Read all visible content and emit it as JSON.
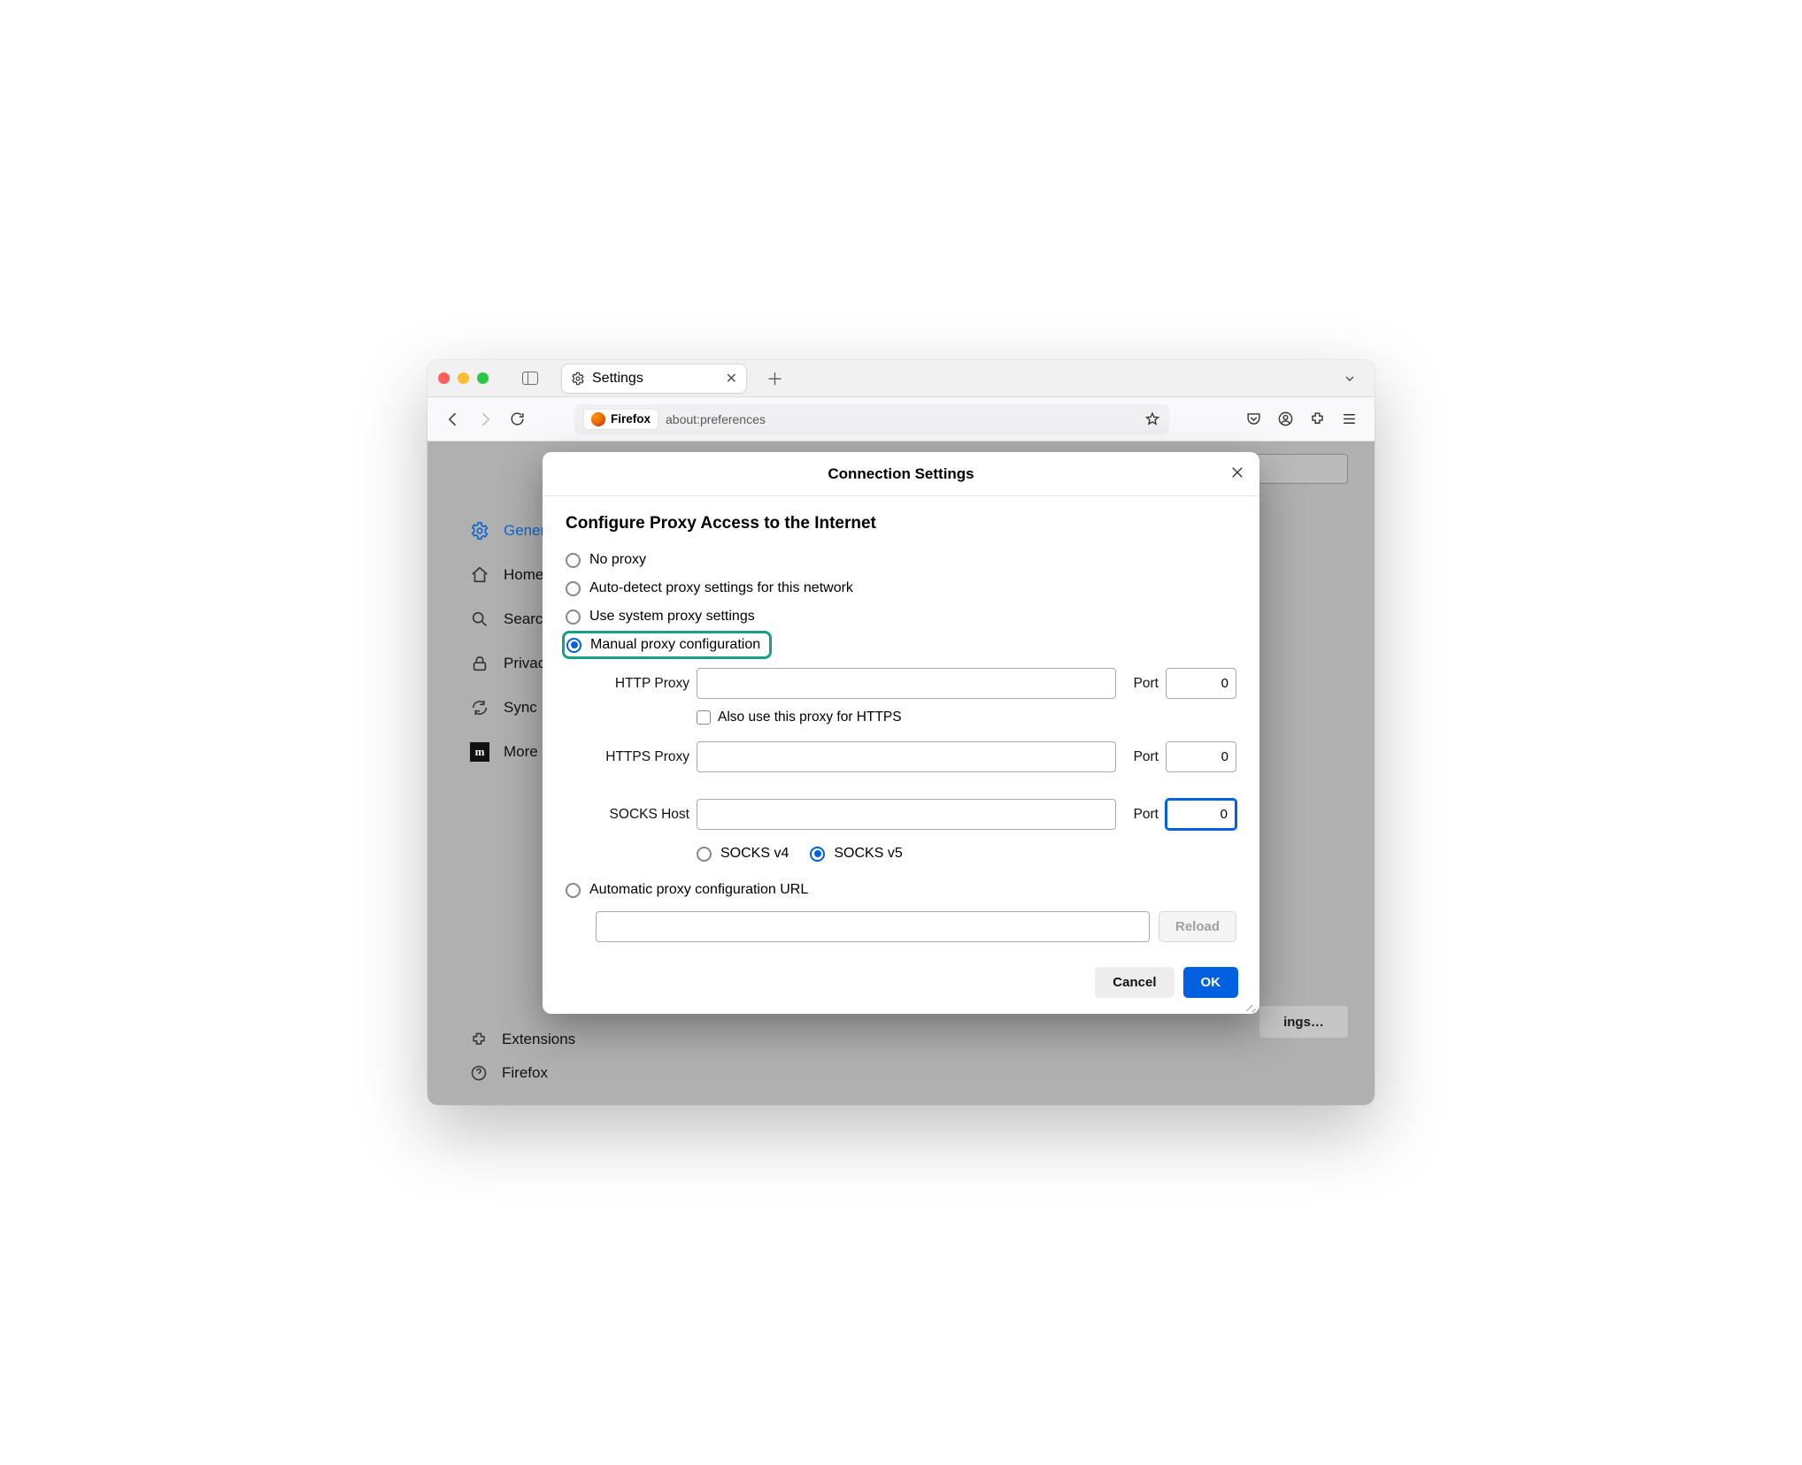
{
  "tab": {
    "title": "Settings"
  },
  "urlbar": {
    "badge": "Firefox",
    "url": "about:preferences"
  },
  "sidebar": {
    "items": [
      {
        "label": "General"
      },
      {
        "label": "Home"
      },
      {
        "label": "Search"
      },
      {
        "label": "Privacy"
      },
      {
        "label": "Sync"
      },
      {
        "label": "More"
      }
    ],
    "bottom": [
      {
        "label": "Extensions"
      },
      {
        "label": "Firefox"
      }
    ]
  },
  "bg_button": "ings…",
  "dialog": {
    "title": "Connection Settings",
    "section_title": "Configure Proxy Access to the Internet",
    "options": {
      "no_proxy": "No proxy",
      "auto_detect": "Auto-detect proxy settings for this network",
      "system": "Use system proxy settings",
      "manual": "Manual proxy configuration",
      "auto_url": "Automatic proxy configuration URL"
    },
    "labels": {
      "http": "HTTP Proxy",
      "https": "HTTPS Proxy",
      "socks": "SOCKS Host",
      "port": "Port",
      "also_https": "Also use this proxy for HTTPS",
      "socks_v4": "SOCKS v4",
      "socks_v5": "SOCKS v5"
    },
    "values": {
      "http_proxy": "",
      "http_port": "0",
      "https_proxy": "",
      "https_port": "0",
      "socks_host": "",
      "socks_port": "0",
      "auto_url": ""
    },
    "buttons": {
      "reload": "Reload",
      "cancel": "Cancel",
      "ok": "OK"
    }
  }
}
